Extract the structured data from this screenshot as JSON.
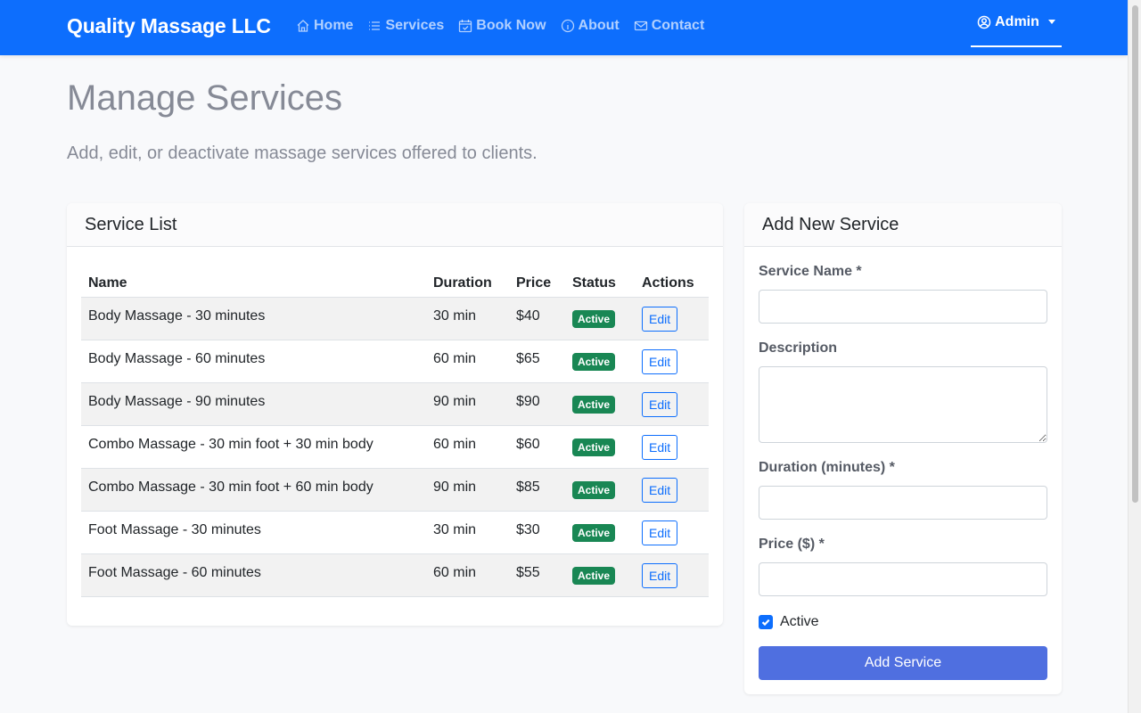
{
  "nav": {
    "brand": "Quality Massage LLC",
    "links": [
      {
        "label": "Home",
        "icon": "home-icon"
      },
      {
        "label": "Services",
        "icon": "list-icon"
      },
      {
        "label": "Book Now",
        "icon": "calendar-check-icon"
      },
      {
        "label": "About",
        "icon": "info-icon"
      },
      {
        "label": "Contact",
        "icon": "envelope-icon"
      }
    ],
    "user": "Admin",
    "bg_color": "#0d6efd"
  },
  "page": {
    "title": "Manage Services",
    "subtitle": "Add, edit, or deactivate massage services offered to clients."
  },
  "service_list": {
    "title": "Service List",
    "columns": [
      "Name",
      "Duration",
      "Price",
      "Status",
      "Actions"
    ],
    "rows": [
      {
        "name": "Body Massage - 30 minutes",
        "duration": "30 min",
        "price": "$40",
        "status": "Active",
        "action": "Edit"
      },
      {
        "name": "Body Massage - 60 minutes",
        "duration": "60 min",
        "price": "$65",
        "status": "Active",
        "action": "Edit"
      },
      {
        "name": "Body Massage - 90 minutes",
        "duration": "90 min",
        "price": "$90",
        "status": "Active",
        "action": "Edit"
      },
      {
        "name": "Combo Massage - 30 min foot + 30 min body",
        "duration": "60 min",
        "price": "$60",
        "status": "Active",
        "action": "Edit"
      },
      {
        "name": "Combo Massage - 30 min foot + 60 min body",
        "duration": "90 min",
        "price": "$85",
        "status": "Active",
        "action": "Edit"
      },
      {
        "name": "Foot Massage - 30 minutes",
        "duration": "30 min",
        "price": "$30",
        "status": "Active",
        "action": "Edit"
      },
      {
        "name": "Foot Massage - 60 minutes",
        "duration": "60 min",
        "price": "$55",
        "status": "Active",
        "action": "Edit"
      }
    ],
    "status_color": "#198754"
  },
  "add_form": {
    "title": "Add New Service",
    "name_label": "Service Name *",
    "name_value": "",
    "description_label": "Description",
    "description_value": "",
    "duration_label": "Duration (minutes) *",
    "duration_value": "",
    "price_label": "Price ($) *",
    "price_value": "",
    "active_label": "Active",
    "active_checked": true,
    "submit_label": "Add Service"
  }
}
